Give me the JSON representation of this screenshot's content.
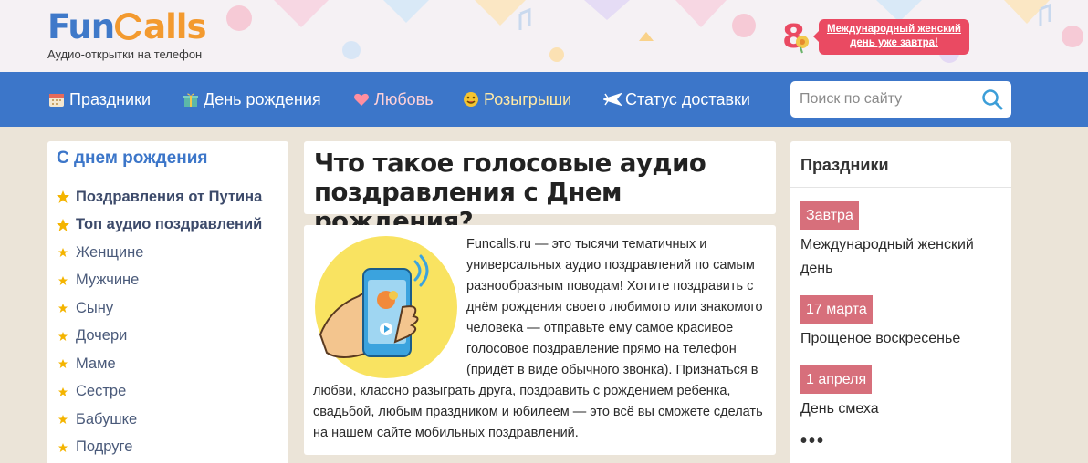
{
  "header": {
    "logo_fun": "Fun",
    "logo_calls": "alls",
    "tagline": "Аудио-открытки на телефон",
    "promo_line1": "Международный женский",
    "promo_line2": "день уже завтра!",
    "promo_number": "8"
  },
  "nav": {
    "items": [
      {
        "label": "Праздники",
        "icon": "calendar-icon"
      },
      {
        "label": "День рождения",
        "icon": "gift-icon"
      },
      {
        "label": "Любовь",
        "icon": "heart-icon"
      },
      {
        "label": "Розыгрыши",
        "icon": "smiley-icon"
      },
      {
        "label": "Статус доставки",
        "icon": "airplane-icon"
      }
    ],
    "search_placeholder": "Поиск по сайту"
  },
  "left": {
    "title": "С днем рождения",
    "items": [
      {
        "label": "Поздравления от Путина",
        "bold": true
      },
      {
        "label": "Топ аудио поздравлений",
        "bold": true
      },
      {
        "label": "Женщине"
      },
      {
        "label": "Мужчине"
      },
      {
        "label": "Сыну"
      },
      {
        "label": "Дочери"
      },
      {
        "label": "Маме"
      },
      {
        "label": "Сестре"
      },
      {
        "label": "Бабушке"
      },
      {
        "label": "Подруге"
      }
    ]
  },
  "main": {
    "title": "Что такое голосовые аудио поздравления с Днем рождения?",
    "body": "Funcalls.ru — это тысячи тематичных и универсальных аудио поздравлений по самым разнообразным поводам! Хотите поздравить с днём рождения своего любимого или знакомого человека — отправьте ему самое красивое голосовое поздравление прямо на телефон (придёт в виде обычного звонка). Признаться в любви, классно разыграть друга, поздравить с рождением ребенка, свадьбой, любым праздником и юбилеем — это всё вы сможете сделать на нашем сайте мобильных поздравлений."
  },
  "right": {
    "title": "Праздники",
    "holidays": [
      {
        "date": "Завтра",
        "name": "Международный женский день"
      },
      {
        "date": "17 марта",
        "name": "Прощеное воскресенье"
      },
      {
        "date": "1 апреля",
        "name": "День смеха"
      }
    ],
    "more": "•••"
  },
  "colors": {
    "brand_blue": "#3c76c9",
    "brand_orange": "#f39a2f",
    "promo_red": "#ea4a62",
    "badge_rose": "#d76f7b",
    "star_yellow": "#f4b400"
  }
}
